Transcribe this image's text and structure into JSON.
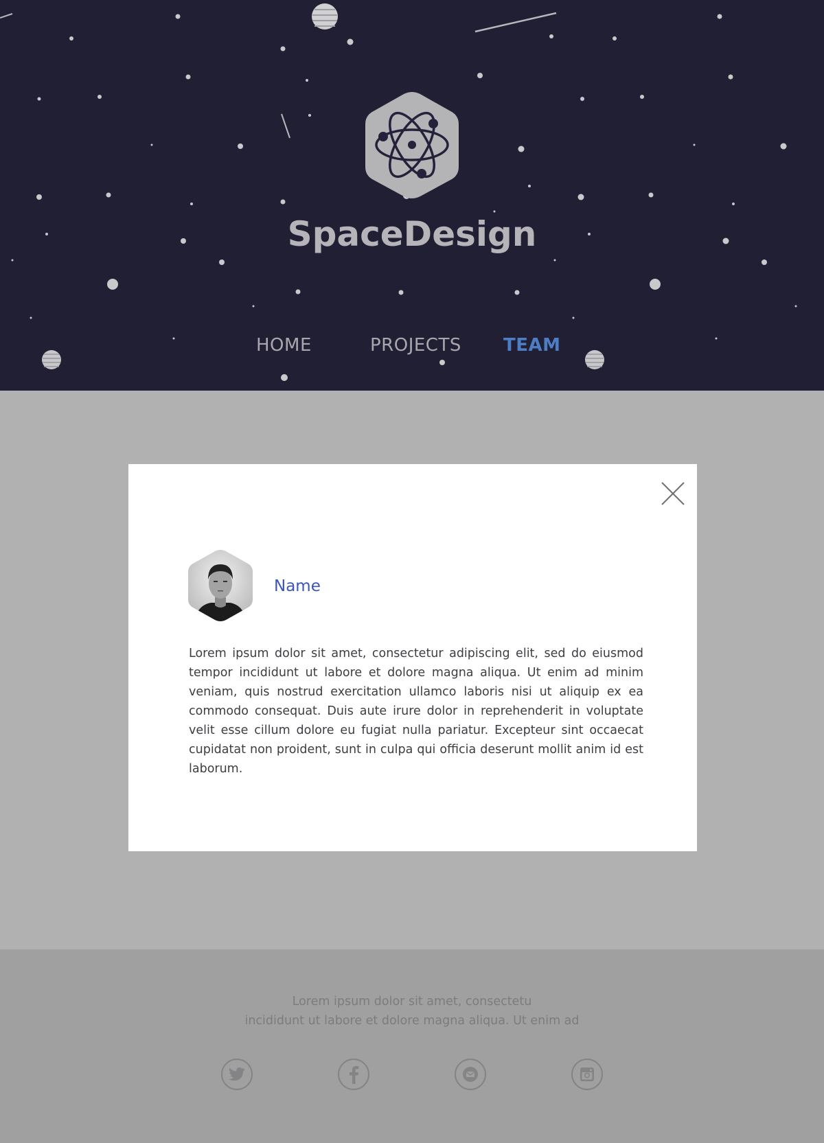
{
  "brand": {
    "name": "SpaceDesign",
    "logo_icon": "atom-hexagon-icon"
  },
  "nav": {
    "items": [
      {
        "label": "HOME",
        "active": false
      },
      {
        "label": "PROJECTS",
        "active": false
      },
      {
        "label": "TEAM",
        "active": true
      }
    ]
  },
  "modal": {
    "close_icon": "close-icon",
    "member": {
      "name": "Name",
      "bio": "Lorem ipsum dolor sit amet, consectetur adipiscing elit, sed do eiusmod tempor incididunt ut labore et dolore magna aliqua. Ut enim ad minim veniam, quis nostrud exercitation ullamco laboris nisi ut aliquip ex ea commodo consequat. Duis aute irure dolor in reprehenderit in voluptate velit esse cillum dolore eu fugiat nulla pariatur. Excepteur sint occaecat cupidatat non proident, sunt in culpa qui officia deserunt mollit anim id est laborum."
    }
  },
  "footer": {
    "line1": "Lorem ipsum dolor sit amet, consectetu",
    "line2": "incididunt ut labore et dolore magna aliqua. Ut enim ad",
    "social": [
      "twitter-icon",
      "facebook-icon",
      "mail-icon",
      "instagram-icon"
    ]
  },
  "colors": {
    "header_bg": "#211f33",
    "nav_active": "#4d7ec3",
    "name_accent": "#3b57b3",
    "page_bg": "#b1b1b1",
    "footer_bg": "#a0a0a0"
  }
}
